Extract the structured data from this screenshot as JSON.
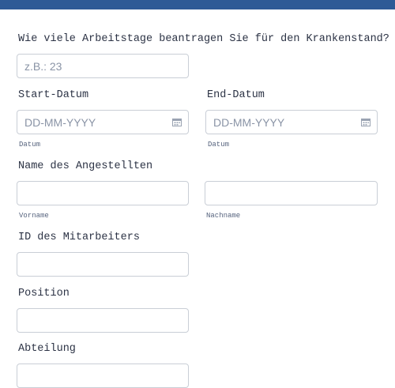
{
  "form": {
    "days_question": "Wie viele Arbeitstage beantragen Sie für den Krankenstand?",
    "days_placeholder": "z.B.: 23",
    "start_label": "Start-Datum",
    "start_placeholder": "DD-MM-YYYY",
    "start_sub": "Datum",
    "end_label": "End-Datum",
    "end_placeholder": "DD-MM-YYYY",
    "end_sub": "Datum",
    "name_label": "Name des Angestellten",
    "first_sub": "Vorname",
    "last_sub": "Nachname",
    "id_label": "ID des Mitarbeiters",
    "position_label": "Position",
    "department_label": "Abteilung"
  },
  "colors": {
    "header": "#2e5a96",
    "border": "#c9ced6",
    "text": "#2c3345"
  },
  "icons": [
    "calendar-icon",
    "calendar-icon"
  ]
}
